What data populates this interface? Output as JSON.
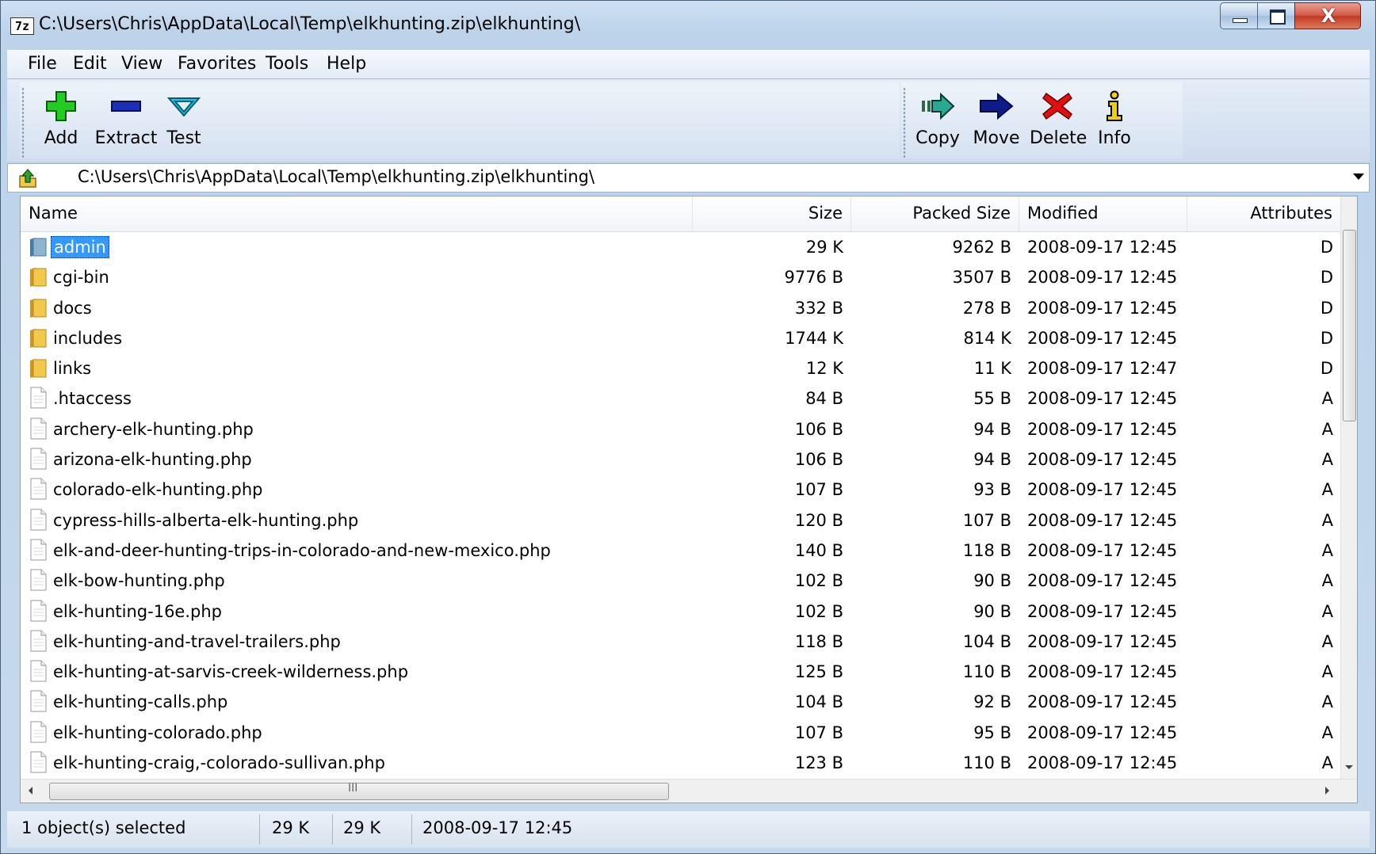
{
  "window": {
    "title": "C:\\Users\\Chris\\AppData\\Local\\Temp\\elkhunting.zip\\elkhunting\\",
    "app_icon_text": "7z",
    "close_glyph": "X"
  },
  "menu": [
    "File",
    "Edit",
    "View",
    "Favorites",
    "Tools",
    "Help"
  ],
  "toolbar": {
    "add": "Add",
    "extract": "Extract",
    "test": "Test",
    "copy": "Copy",
    "move": "Move",
    "delete": "Delete",
    "info": "Info"
  },
  "address": {
    "path": "C:\\Users\\Chris\\AppData\\Local\\Temp\\elkhunting.zip\\elkhunting\\"
  },
  "columns": {
    "name": "Name",
    "size": "Size",
    "packed": "Packed Size",
    "modified": "Modified",
    "attributes": "Attributes"
  },
  "rows": [
    {
      "name": "admin",
      "type": "folder",
      "size": "29 K",
      "packed": "9262 B",
      "modified": "2008-09-17 12:45",
      "attr": "D",
      "selected": true
    },
    {
      "name": "cgi-bin",
      "type": "folder",
      "size": "9776 B",
      "packed": "3507 B",
      "modified": "2008-09-17 12:45",
      "attr": "D"
    },
    {
      "name": "docs",
      "type": "folder",
      "size": "332 B",
      "packed": "278 B",
      "modified": "2008-09-17 12:45",
      "attr": "D"
    },
    {
      "name": "includes",
      "type": "folder",
      "size": "1744 K",
      "packed": "814 K",
      "modified": "2008-09-17 12:45",
      "attr": "D"
    },
    {
      "name": "links",
      "type": "folder",
      "size": "12 K",
      "packed": "11 K",
      "modified": "2008-09-17 12:47",
      "attr": "D"
    },
    {
      "name": ".htaccess",
      "type": "file",
      "size": "84 B",
      "packed": "55 B",
      "modified": "2008-09-17 12:45",
      "attr": "A"
    },
    {
      "name": "archery-elk-hunting.php",
      "type": "file",
      "size": "106 B",
      "packed": "94 B",
      "modified": "2008-09-17 12:45",
      "attr": "A"
    },
    {
      "name": "arizona-elk-hunting.php",
      "type": "file",
      "size": "106 B",
      "packed": "94 B",
      "modified": "2008-09-17 12:45",
      "attr": "A"
    },
    {
      "name": "colorado-elk-hunting.php",
      "type": "file",
      "size": "107 B",
      "packed": "93 B",
      "modified": "2008-09-17 12:45",
      "attr": "A"
    },
    {
      "name": "cypress-hills-alberta-elk-hunting.php",
      "type": "file",
      "size": "120 B",
      "packed": "107 B",
      "modified": "2008-09-17 12:45",
      "attr": "A"
    },
    {
      "name": "elk-and-deer-hunting-trips-in-colorado-and-new-mexico.php",
      "type": "file",
      "size": "140 B",
      "packed": "118 B",
      "modified": "2008-09-17 12:45",
      "attr": "A"
    },
    {
      "name": "elk-bow-hunting.php",
      "type": "file",
      "size": "102 B",
      "packed": "90 B",
      "modified": "2008-09-17 12:45",
      "attr": "A"
    },
    {
      "name": "elk-hunting-16e.php",
      "type": "file",
      "size": "102 B",
      "packed": "90 B",
      "modified": "2008-09-17 12:45",
      "attr": "A"
    },
    {
      "name": "elk-hunting-and-travel-trailers.php",
      "type": "file",
      "size": "118 B",
      "packed": "104 B",
      "modified": "2008-09-17 12:45",
      "attr": "A"
    },
    {
      "name": "elk-hunting-at-sarvis-creek-wilderness.php",
      "type": "file",
      "size": "125 B",
      "packed": "110 B",
      "modified": "2008-09-17 12:45",
      "attr": "A"
    },
    {
      "name": "elk-hunting-calls.php",
      "type": "file",
      "size": "104 B",
      "packed": "92 B",
      "modified": "2008-09-17 12:45",
      "attr": "A"
    },
    {
      "name": "elk-hunting-colorado.php",
      "type": "file",
      "size": "107 B",
      "packed": "95 B",
      "modified": "2008-09-17 12:45",
      "attr": "A"
    },
    {
      "name": "elk-hunting-craig,-colorado-sullivan.php",
      "type": "file",
      "size": "123 B",
      "packed": "110 B",
      "modified": "2008-09-17 12:45",
      "attr": "A"
    }
  ],
  "hscroll_grip": "III",
  "status": {
    "selection": "1 object(s) selected",
    "size": "29 K",
    "packed": "29 K",
    "modified": "2008-09-17 12:45"
  },
  "colors": {
    "selection": "#3399ff",
    "folder": "#f2c94c",
    "add_icon": "#22cc22",
    "extract_icon": "#1a2fb8",
    "test_icon": "#19c8e8",
    "delete_icon": "#e01010"
  }
}
